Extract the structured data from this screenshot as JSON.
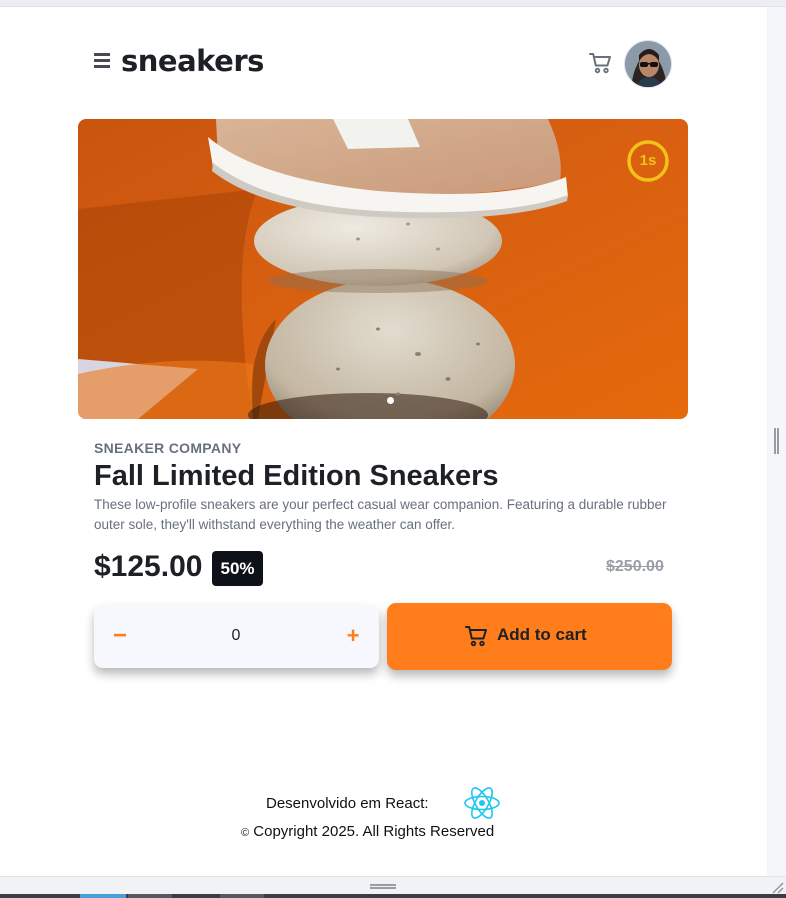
{
  "header": {
    "logo": "sneakers",
    "menu_icon": "hamburger-menu-icon",
    "cart_icon": "cart-icon",
    "avatar_icon": "user-avatar"
  },
  "hero": {
    "timer_label": "1s",
    "slide_count": 1,
    "active_slide": 1
  },
  "product": {
    "company": "SNEAKER COMPANY",
    "title": "Fall Limited Edition Sneakers",
    "description": "These low-profile sneakers are your perfect casual wear companion. Featuring a durable rubber outer sole, they'll withstand everything the weather can offer.",
    "price": "$125.00",
    "discount": "50%",
    "original_price": "$250.00"
  },
  "cart_controls": {
    "minus_label": "−",
    "quantity": "0",
    "plus_label": "+",
    "add_label": "Add to cart"
  },
  "footer": {
    "developed_with": "Desenvolvido em React:",
    "copyright_symbol": "©",
    "copyright": "Copyright 2025. All Rights Reserved",
    "react_icon": "react-logo-icon"
  },
  "colors": {
    "accent": "#ff7e1b",
    "dark": "#1d2025",
    "muted": "#68707d",
    "timer": "#f2c21a",
    "react": "#19c6f4"
  }
}
